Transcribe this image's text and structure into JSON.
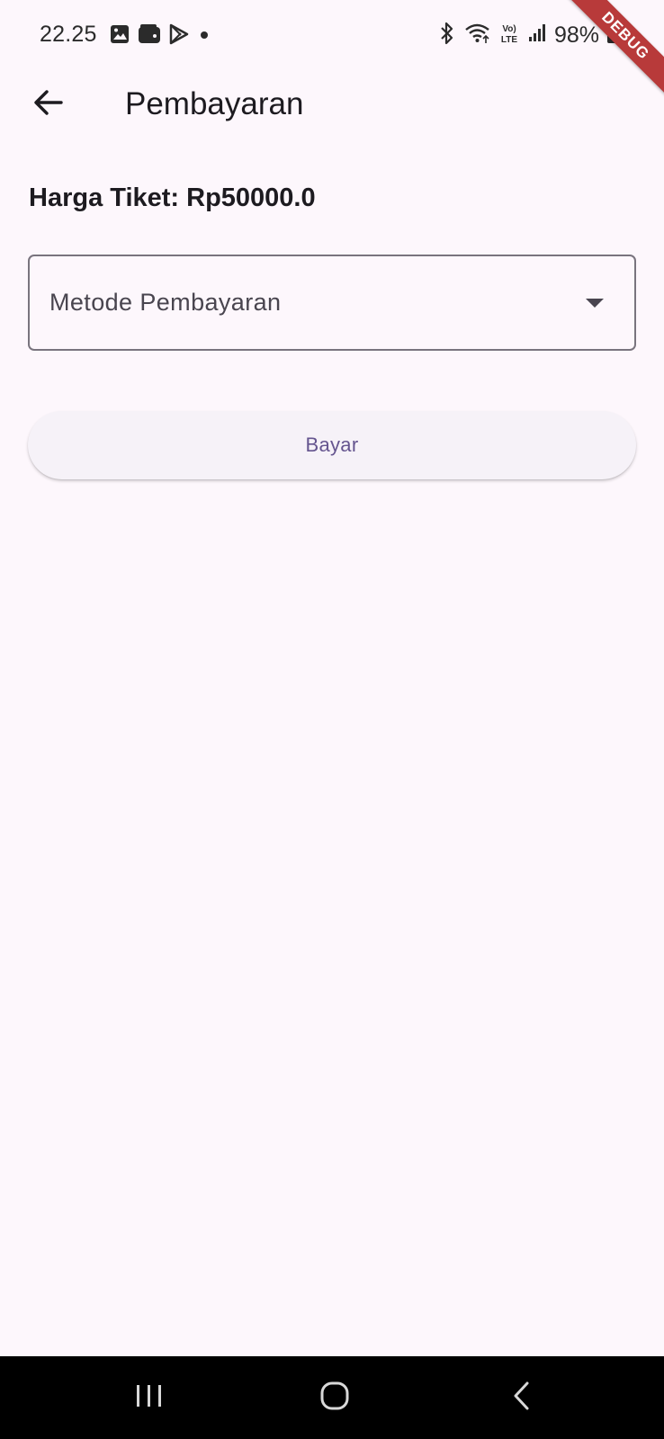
{
  "status_bar": {
    "time": "22.25",
    "battery": "98%",
    "left_icons": [
      "gallery-icon",
      "wallet-icon",
      "play-store-icon",
      "dot-icon"
    ],
    "right_icons": [
      "bluetooth-icon",
      "wifi-icon",
      "volte-icon",
      "signal-icon",
      "battery-icon"
    ]
  },
  "debug_banner": "DEBUG",
  "app_bar": {
    "title": "Pembayaran",
    "back_icon": "arrow-back-icon"
  },
  "content": {
    "price_label": "Harga Tiket: Rp50000.0",
    "payment_method": {
      "label": "Metode Pembayaran",
      "icon": "dropdown-arrow-icon"
    },
    "pay_button_label": "Bayar"
  },
  "nav_bar": {
    "buttons": [
      "recents-icon",
      "home-icon",
      "back-icon"
    ]
  },
  "colors": {
    "background": "#fdf7fc",
    "text_primary": "#1d1b20",
    "outline": "#79747e",
    "button_surface": "#f6f2f8",
    "button_text": "#65558f",
    "debug_ribbon": "#b83a3a",
    "nav_bar": "#000000"
  }
}
